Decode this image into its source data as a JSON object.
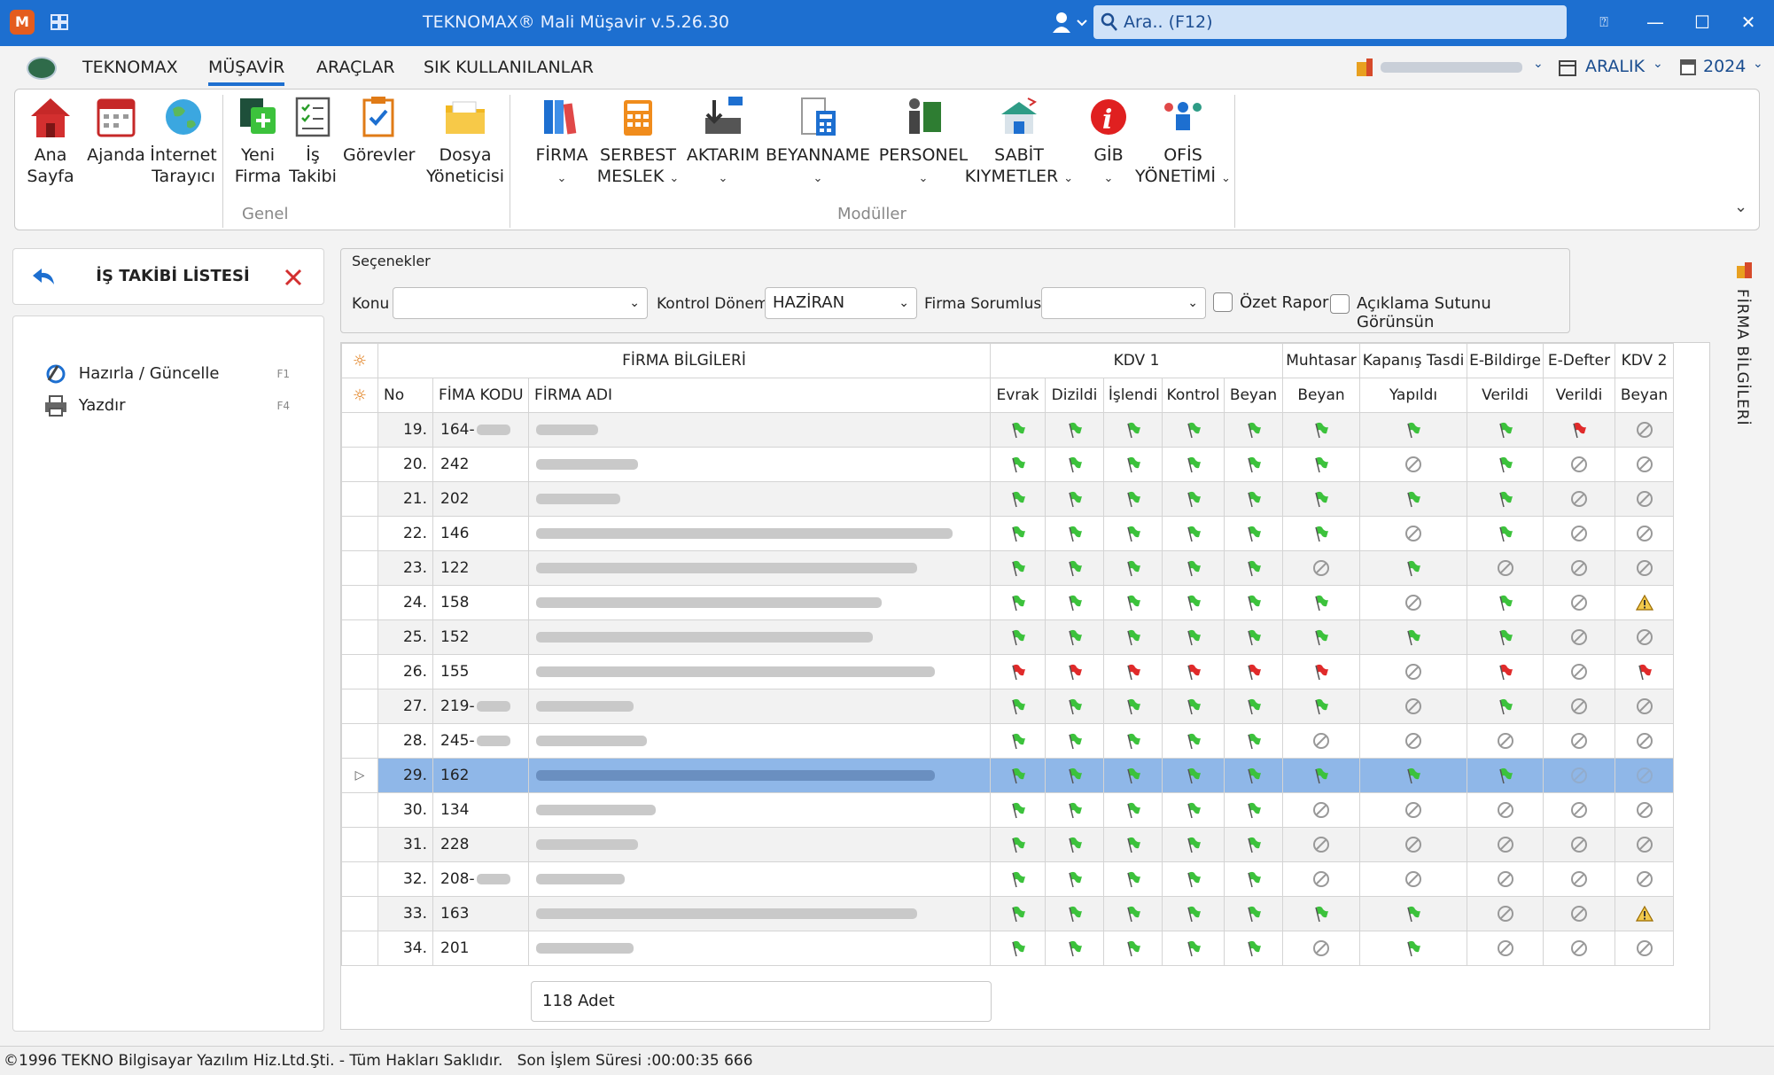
{
  "titlebar": {
    "app_title": "TEKNOMAX® Mali Müşavir v.5.26.30",
    "search_placeholder": "Ara.. (F12)",
    "app_logo_text": "M"
  },
  "menu": {
    "items": [
      "TEKNOMAX",
      "MÜŞAVİR",
      "ARAÇLAR",
      "SIK KULLANILANLAR"
    ],
    "active": "MÜŞAVİR",
    "month": "ARALIK",
    "year": "2024"
  },
  "ribbon": {
    "genel_label": "Genel",
    "moduller_label": "Modüller",
    "genel": [
      {
        "line1": "Ana",
        "line2": "Sayfa"
      },
      {
        "line1": "Ajanda",
        "line2": ""
      },
      {
        "line1": "İnternet",
        "line2": "Tarayıcı"
      },
      {
        "line1": "Yeni",
        "line2": "Firma"
      },
      {
        "line1": "İş",
        "line2": "Takibi"
      },
      {
        "line1": "Görevler",
        "line2": ""
      },
      {
        "line1": "Dosya",
        "line2": "Yöneticisi"
      }
    ],
    "moduller": [
      {
        "line1": "FİRMA",
        "line2": ""
      },
      {
        "line1": "SERBEST",
        "line2": "MESLEK"
      },
      {
        "line1": "AKTARIM",
        "line2": ""
      },
      {
        "line1": "BEYANNAME",
        "line2": ""
      },
      {
        "line1": "PERSONEL",
        "line2": ""
      },
      {
        "line1": "SABİT",
        "line2": "KIYMETLER"
      },
      {
        "line1": "GİB",
        "line2": ""
      },
      {
        "line1": "OFİS",
        "line2": "YÖNETİMİ"
      }
    ]
  },
  "left_panel": {
    "title": "İŞ TAKİBİ LİSTESİ",
    "items": [
      {
        "label": "Hazırla / Güncelle",
        "key": "F1"
      },
      {
        "label": "Yazdır",
        "key": "F4"
      }
    ]
  },
  "options": {
    "legend": "Seçenekler",
    "konu_label": "Konu",
    "konu_value": "",
    "kontrol_label": "Kontrol Dönemi",
    "kontrol_value": "HAZİRAN",
    "sorumlu_label": "Firma Sorumlusu",
    "sorumlu_value": "",
    "ozet_label": "Özet Rapor",
    "aciklama_label": "Açıklama Sutunu Görünsün"
  },
  "grid": {
    "group_headers": {
      "firma": "FİRMA BİLGİLERİ",
      "kdv1": "KDV 1",
      "muhtasar": "Muhtasar",
      "kapanis": "Kapanış Tasdi",
      "ebildirge": "E-Bildirge",
      "edefter": "E-Defter",
      "kdv2": "KDV 2"
    },
    "columns": [
      "No",
      "FİMA KODU",
      "FİRMA ADI",
      "Evrak",
      "Dizildi",
      "İşlendi",
      "Kontrol",
      "Beyan",
      "Beyan",
      "Yapıldı",
      "Verildi",
      "Verildi",
      "Beyan"
    ],
    "rows": [
      {
        "no": "19.",
        "code": "164-",
        "code_blur": true,
        "name_w": 70,
        "s": [
          "g",
          "g",
          "g",
          "g",
          "g",
          "g",
          "g",
          "g",
          "r",
          "n"
        ]
      },
      {
        "no": "20.",
        "code": "242",
        "code_blur": false,
        "name_w": 115,
        "s": [
          "g",
          "g",
          "g",
          "g",
          "g",
          "g",
          "n",
          "g",
          "n",
          "n"
        ]
      },
      {
        "no": "21.",
        "code": "202",
        "code_blur": false,
        "name_w": 95,
        "s": [
          "g",
          "g",
          "g",
          "g",
          "g",
          "g",
          "g",
          "g",
          "n",
          "n"
        ]
      },
      {
        "no": "22.",
        "code": "146",
        "code_blur": false,
        "name_w": 470,
        "s": [
          "g",
          "g",
          "g",
          "g",
          "g",
          "g",
          "n",
          "g",
          "n",
          "n"
        ]
      },
      {
        "no": "23.",
        "code": "122",
        "code_blur": false,
        "name_w": 430,
        "s": [
          "g",
          "g",
          "g",
          "g",
          "g",
          "n",
          "g",
          "n",
          "n",
          "n"
        ]
      },
      {
        "no": "24.",
        "code": "158",
        "code_blur": false,
        "name_w": 390,
        "s": [
          "g",
          "g",
          "g",
          "g",
          "g",
          "g",
          "n",
          "g",
          "n",
          "w"
        ]
      },
      {
        "no": "25.",
        "code": "152",
        "code_blur": false,
        "name_w": 380,
        "s": [
          "g",
          "g",
          "g",
          "g",
          "g",
          "g",
          "g",
          "g",
          "n",
          "n"
        ]
      },
      {
        "no": "26.",
        "code": "155",
        "code_blur": false,
        "name_w": 450,
        "s": [
          "r",
          "r",
          "r",
          "r",
          "r",
          "r",
          "n",
          "r",
          "n",
          "r"
        ]
      },
      {
        "no": "27.",
        "code": "219-",
        "code_blur": true,
        "name_w": 110,
        "s": [
          "g",
          "g",
          "g",
          "g",
          "g",
          "g",
          "n",
          "g",
          "n",
          "n"
        ]
      },
      {
        "no": "28.",
        "code": "245-",
        "code_blur": true,
        "name_w": 125,
        "s": [
          "g",
          "g",
          "g",
          "g",
          "g",
          "n",
          "n",
          "n",
          "n",
          "n"
        ]
      },
      {
        "no": "29.",
        "code": "162",
        "code_blur": false,
        "name_w": 450,
        "selected": true,
        "s": [
          "g",
          "g",
          "g",
          "g",
          "g",
          "g",
          "g",
          "g",
          "n",
          "n"
        ]
      },
      {
        "no": "30.",
        "code": "134",
        "code_blur": false,
        "name_w": 135,
        "s": [
          "g",
          "g",
          "g",
          "g",
          "g",
          "n",
          "n",
          "n",
          "n",
          "n"
        ]
      },
      {
        "no": "31.",
        "code": "228",
        "code_blur": false,
        "name_w": 115,
        "s": [
          "g",
          "g",
          "g",
          "g",
          "g",
          "n",
          "n",
          "n",
          "n",
          "n"
        ]
      },
      {
        "no": "32.",
        "code": "208-",
        "code_blur": true,
        "name_w": 100,
        "s": [
          "g",
          "g",
          "g",
          "g",
          "g",
          "n",
          "n",
          "n",
          "n",
          "n"
        ]
      },
      {
        "no": "33.",
        "code": "163",
        "code_blur": false,
        "name_w": 430,
        "s": [
          "g",
          "g",
          "g",
          "g",
          "g",
          "g",
          "g",
          "n",
          "n",
          "w"
        ]
      },
      {
        "no": "34.",
        "code": "201",
        "code_blur": false,
        "name_w": 110,
        "s": [
          "g",
          "g",
          "g",
          "g",
          "g",
          "n",
          "g",
          "n",
          "n",
          "n"
        ]
      }
    ],
    "count_text": "118 Adet"
  },
  "vertical_tab": "FİRMA BİLGİLERİ",
  "status": {
    "copyright": "©1996 TEKNO Bilgisayar Yazılım Hiz.Ltd.Şti. - Tüm Hakları Saklıdır.",
    "last_op": "Son İşlem Süresi :00:00:35 666"
  },
  "colors": {
    "titlebar": "#1d6fd0",
    "flag_green": "#3cc23c",
    "flag_red": "#e02a2a",
    "selected_row": "#8fb7e8"
  }
}
